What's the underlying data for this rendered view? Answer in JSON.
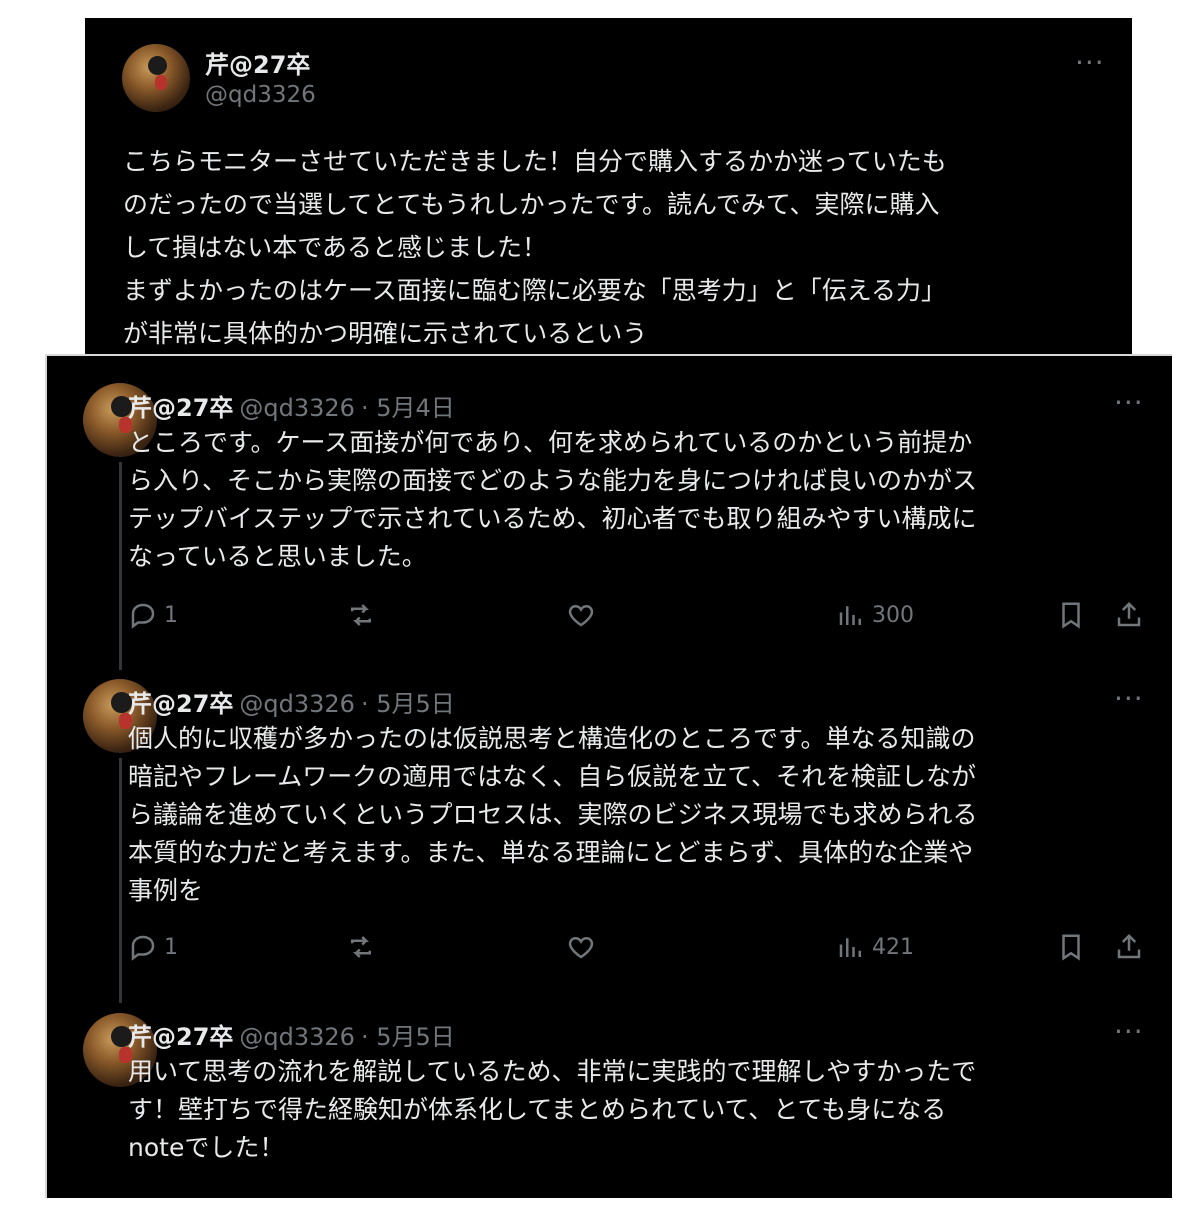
{
  "top_post": {
    "name": "芹@27卒",
    "handle": "@qd3326",
    "more": "···",
    "text": "こちらモニターさせていただきました！自分で購入するかか迷っていたも\nのだったので当選してとてもうれしかったです。読んでみて、実際に購入\nして損はない本であると感じました！\nまずよかったのはケース面接に臨む際に必要な「思考力」と「伝える力」\nが非常に具体的かつ明確に示されているという"
  },
  "thread": [
    {
      "name": "芹@27卒",
      "handle": "@qd3326",
      "date": "· 5月4日",
      "more": "···",
      "text": "ところです。ケース面接が何であり、何を求められているのかという前提か\nら入り、そこから実際の面接でどのような能力を身につければ良いのかがス\nテップバイステップで示されているため、初心者でも取り組みやすい構成に\nなっていると思いました。",
      "replies": "1",
      "views": "300"
    },
    {
      "name": "芹@27卒",
      "handle": "@qd3326",
      "date": "· 5月5日",
      "more": "···",
      "text": "個人的に収穫が多かったのは仮説思考と構造化のところです。単なる知識の\n暗記やフレームワークの適用ではなく、自ら仮説を立て、それを検証しなが\nら議論を進めていくというプロセスは、実際のビジネス現場でも求められる\n本質的な力だと考えます。また、単なる理論にとどまらず、具体的な企業や\n事例を",
      "replies": "1",
      "views": "421"
    },
    {
      "name": "芹@27卒",
      "handle": "@qd3326",
      "date": "· 5月5日",
      "more": "···",
      "text": "用いて思考の流れを解説しているため、非常に実践的で理解しやすかったで\nす！壁打ちで得た経験知が体系化してまとめられていて、とても身になる\nnoteでした！"
    }
  ]
}
